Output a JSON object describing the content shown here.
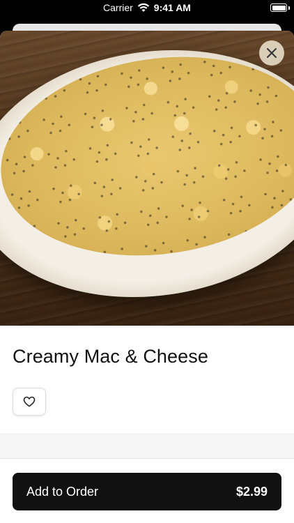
{
  "status_bar": {
    "carrier": "Carrier",
    "time": "9:41 AM",
    "icons": [
      "wifi-icon",
      "battery-icon"
    ]
  },
  "item": {
    "title": "Creamy Mac & Cheese",
    "image_description_icon": "food-photo"
  },
  "actions": {
    "close_icon": "close-icon",
    "favorite_icon": "heart-icon",
    "add_label": "Add to Order",
    "price": "$2.99"
  },
  "colors": {
    "button_bg": "#111111",
    "button_text": "#ffffff",
    "title_text": "#111111",
    "close_bg": "#ebe1cd"
  }
}
